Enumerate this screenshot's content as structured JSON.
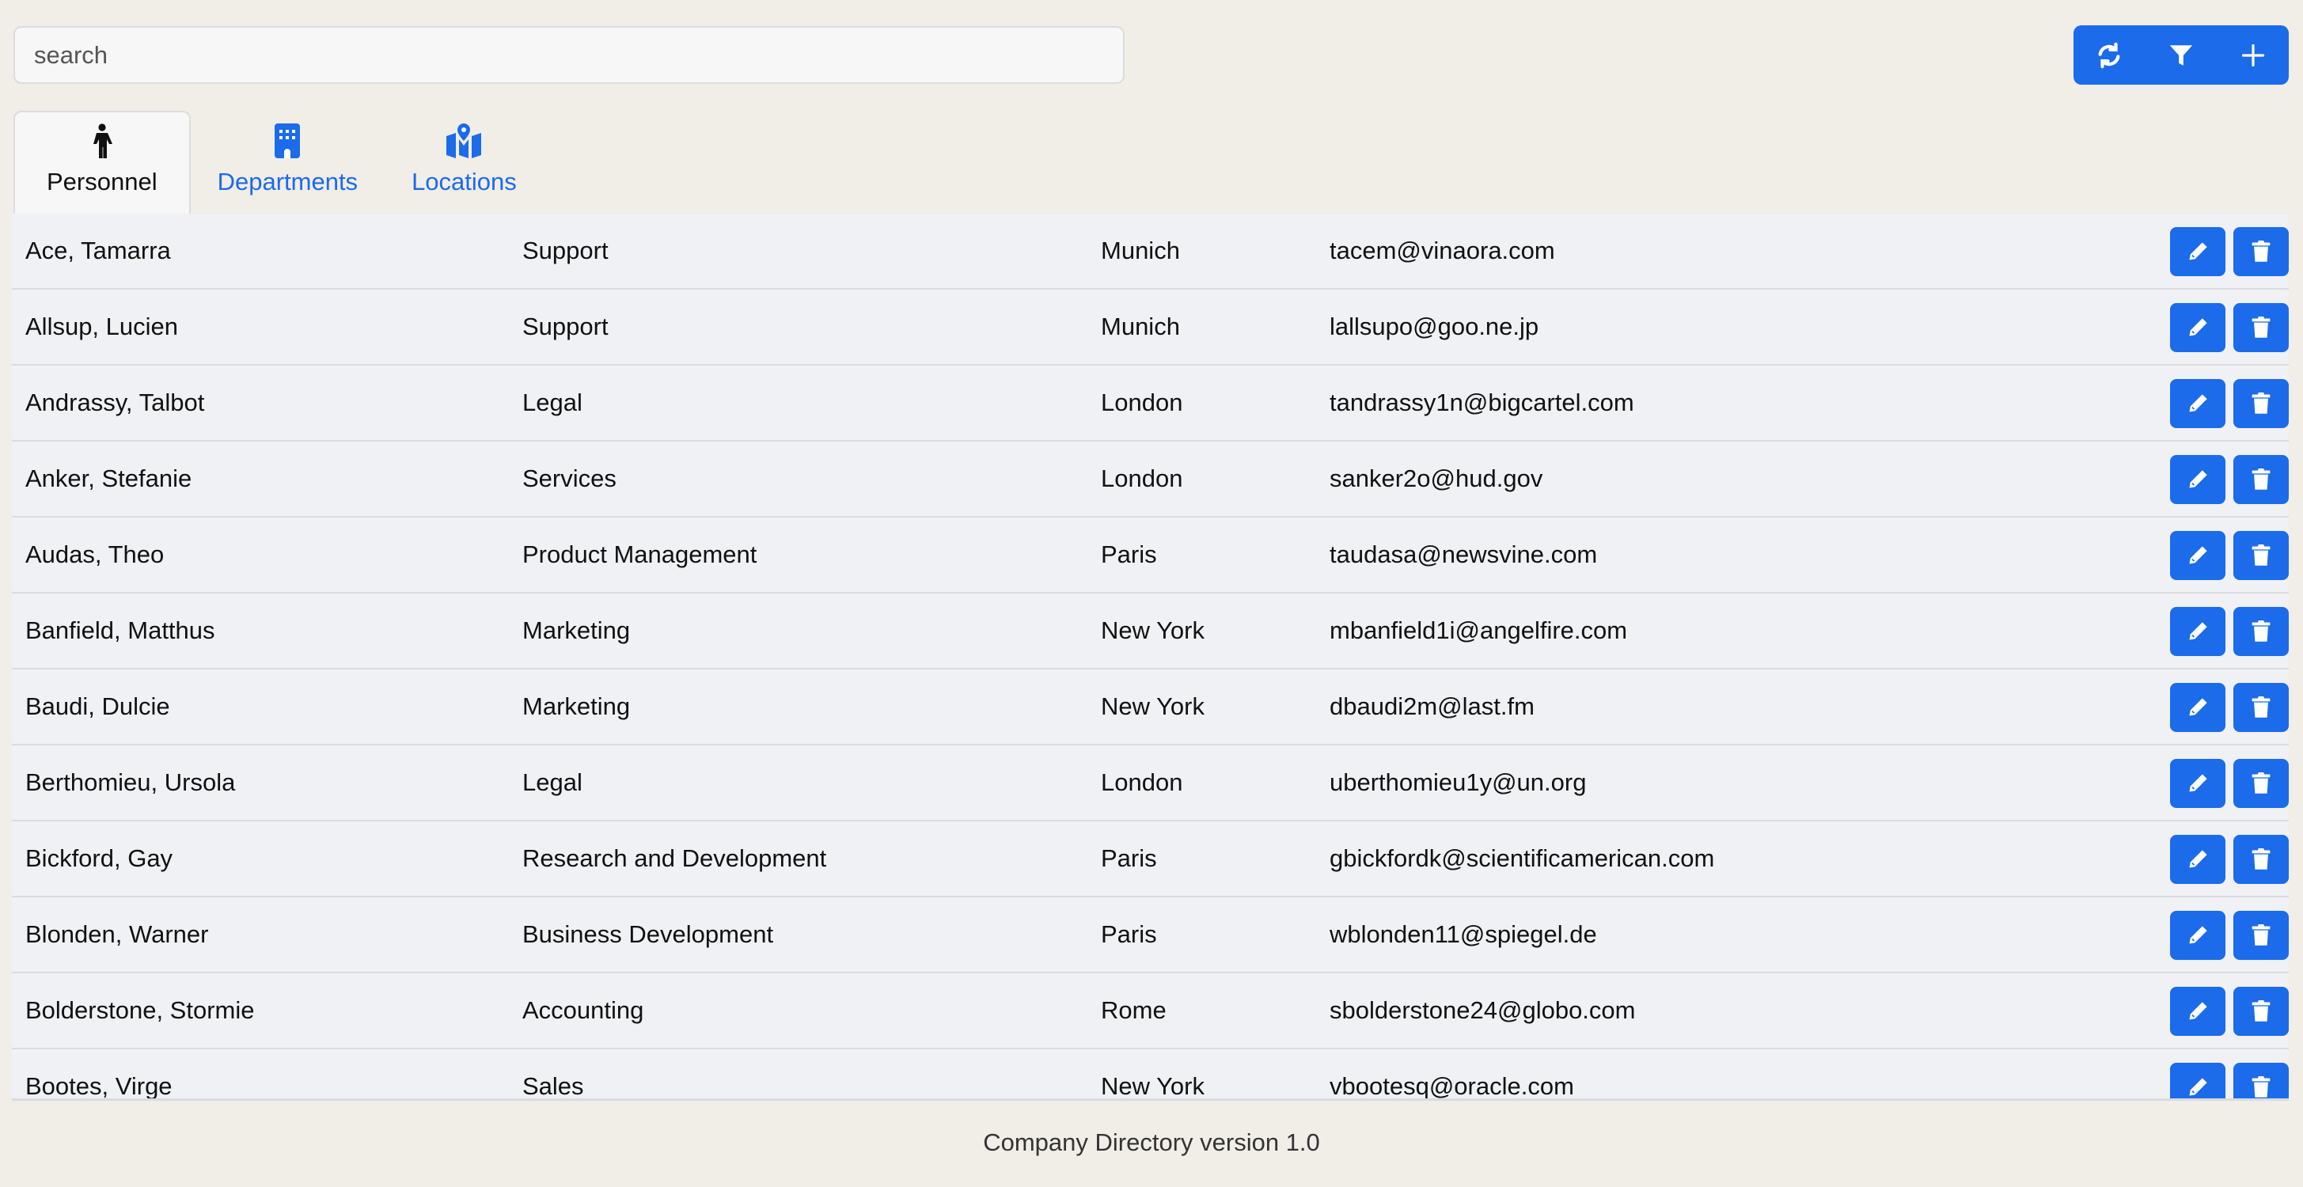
{
  "search": {
    "placeholder": "search",
    "value": ""
  },
  "toolbar": {
    "buttons": [
      {
        "icon": "refresh-icon"
      },
      {
        "icon": "filter-icon"
      },
      {
        "icon": "plus-icon"
      }
    ]
  },
  "tabs": [
    {
      "label": "Personnel",
      "icon": "person-icon",
      "active": true
    },
    {
      "label": "Departments",
      "icon": "building-icon",
      "active": false
    },
    {
      "label": "Locations",
      "icon": "map-location-icon",
      "active": false
    }
  ],
  "personnel": [
    {
      "name": "Ace, Tamarra",
      "department": "Support",
      "location": "Munich",
      "email": "tacem@vinaora.com"
    },
    {
      "name": "Allsup, Lucien",
      "department": "Support",
      "location": "Munich",
      "email": "lallsupo@goo.ne.jp"
    },
    {
      "name": "Andrassy, Talbot",
      "department": "Legal",
      "location": "London",
      "email": "tandrassy1n@bigcartel.com"
    },
    {
      "name": "Anker, Stefanie",
      "department": "Services",
      "location": "London",
      "email": "sanker2o@hud.gov"
    },
    {
      "name": "Audas, Theo",
      "department": "Product Management",
      "location": "Paris",
      "email": "taudasa@newsvine.com"
    },
    {
      "name": "Banfield, Matthus",
      "department": "Marketing",
      "location": "New York",
      "email": "mbanfield1i@angelfire.com"
    },
    {
      "name": "Baudi, Dulcie",
      "department": "Marketing",
      "location": "New York",
      "email": "dbaudi2m@last.fm"
    },
    {
      "name": "Berthomieu, Ursola",
      "department": "Legal",
      "location": "London",
      "email": "uberthomieu1y@un.org"
    },
    {
      "name": "Bickford, Gay",
      "department": "Research and Development",
      "location": "Paris",
      "email": "gbickfordk@scientificamerican.com"
    },
    {
      "name": "Blonden, Warner",
      "department": "Business Development",
      "location": "Paris",
      "email": "wblonden11@spiegel.de"
    },
    {
      "name": "Bolderstone, Stormie",
      "department": "Accounting",
      "location": "Rome",
      "email": "sbolderstone24@globo.com"
    },
    {
      "name": "Bootes, Virge",
      "department": "Sales",
      "location": "New York",
      "email": "vbootesq@oracle.com"
    }
  ],
  "footer": {
    "text": "Company Directory version 1.0"
  },
  "colors": {
    "accent": "#1b6bea",
    "background": "#f1ede7",
    "row": "#eff1f4"
  }
}
